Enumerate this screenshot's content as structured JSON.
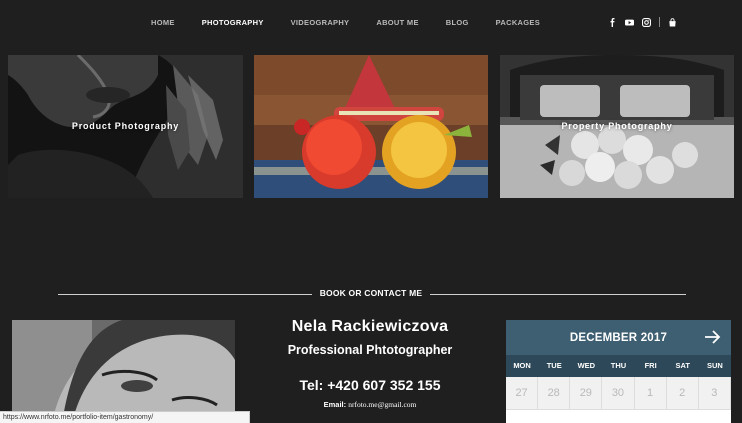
{
  "nav": {
    "items": [
      {
        "label": "HOME",
        "active": false
      },
      {
        "label": "PHOTOGRAPHY",
        "active": true
      },
      {
        "label": "VIDEOGRAPHY",
        "active": false
      },
      {
        "label": "ABOUT ME",
        "active": false
      },
      {
        "label": "BLOG",
        "active": false
      },
      {
        "label": "PACKAGES",
        "active": false
      }
    ],
    "social_icons": [
      "facebook-icon",
      "youtube-icon",
      "instagram-icon"
    ],
    "cart_icon": "shopping-bag-icon"
  },
  "gallery": {
    "tiles": [
      {
        "label": "Product Photography",
        "image": "black-and-white-woman-with-feathers"
      },
      {
        "label": "",
        "image": "colorful-drinks-with-sombrero"
      },
      {
        "label": "Property Photography",
        "image": "black-and-white-bed-with-roses"
      }
    ]
  },
  "section": {
    "title": "BOOK OR CONTACT ME"
  },
  "contact": {
    "name": "Nela Rackiewiczova",
    "role": "Professional Phtotographer",
    "tel": "Tel: +420 607 352 155",
    "email_label": "Email:",
    "email": "nrfoto.me@gmail.com"
  },
  "calendar": {
    "title": "DECEMBER 2017",
    "days": [
      "MON",
      "TUE",
      "WED",
      "THU",
      "FRI",
      "SAT",
      "SUN"
    ],
    "cells": [
      "27",
      "28",
      "29",
      "30",
      "1",
      "2",
      "3"
    ],
    "next_icon": "arrow-right-icon",
    "header_color": "#3e5e71",
    "days_color": "#2d4858"
  },
  "statusbar": {
    "url": "https://www.nrfoto.me/portfolio-item/gastronomy/"
  }
}
